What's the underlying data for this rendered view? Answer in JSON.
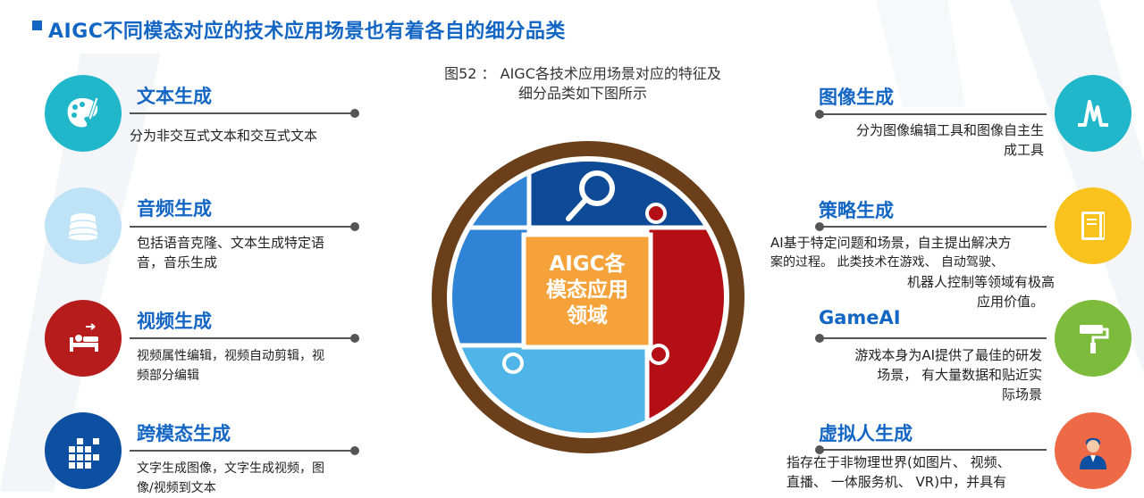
{
  "header": {
    "title": "AIGC不同模态对应的技术应用场景也有着各自的细分品类"
  },
  "caption": {
    "line1": "图52 ： AIGC各技术应用场景对应的特征及",
    "line2": "细分品类如下图所示"
  },
  "center": {
    "lines": [
      "AIGC各",
      "模态应用",
      "领域"
    ]
  },
  "left_items": [
    {
      "title": "文本生成",
      "desc": [
        "分为非交互式文本和交互式文本"
      ],
      "icon": "palette-icon",
      "color": "#1fb7c9"
    },
    {
      "title": "音频生成",
      "desc": [
        "包括语音克隆、文本生成特定语",
        "音，音乐生成"
      ],
      "icon": "pancake-stack-icon",
      "color": "#bfe3f6"
    },
    {
      "title": "视频生成",
      "desc": [
        "视频属性编辑，视频自动剪辑，视",
        "频部分编辑"
      ],
      "icon": "bed-icon",
      "color": "#b71c1c"
    },
    {
      "title": "跨模态生成",
      "desc": [
        "文字生成图像，文字生成视频，图",
        "像/视频到文本"
      ],
      "icon": "grid-blocks-icon",
      "color": "#0d4fa0"
    }
  ],
  "right_items": [
    {
      "title": "图像生成",
      "desc": [
        "分为图像编辑工具和图像自主生",
        "成工具"
      ],
      "icon": "peak-chart-icon",
      "color": "#1fb7c9"
    },
    {
      "title": "策略生成",
      "desc": [
        "AI基于特定问题和场景，自主提出解决方",
        "案的过程。 此类技术在游戏、 自动驾驶、",
        "机器人控制等领域有极高",
        "应用价值。"
      ],
      "icon": "book-icon",
      "color": "#f9c21d"
    },
    {
      "title": "GameAI",
      "desc": [
        "游戏本身为AI提供了最佳的研发",
        "场景， 有大量数据和贴近实",
        "际场景"
      ],
      "icon": "paint-roller-icon",
      "color": "#7dbb3c"
    },
    {
      "title": "虚拟人生成",
      "desc": [
        "指存在于非物理世界(如图片、 视频、",
        "直播、 一体服务机、 VR)中，并具有"
      ],
      "icon": "person-icon",
      "color": "#ee6a47"
    }
  ]
}
